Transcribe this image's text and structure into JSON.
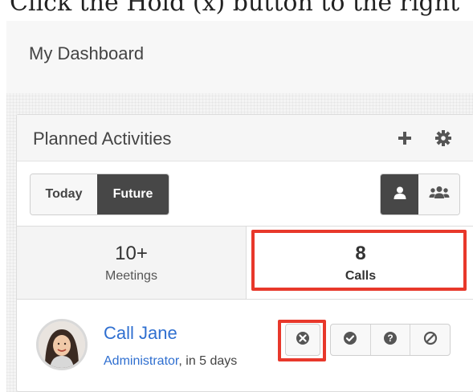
{
  "caption": {
    "text": "Click the Hold (x) button to the right"
  },
  "dashboard": {
    "title": "My Dashboard"
  },
  "dashlet": {
    "title": "Planned Activities",
    "range_buttons": [
      {
        "label": "Today"
      },
      {
        "label": "Future"
      }
    ],
    "selected_range": "Future"
  },
  "tabs": {
    "meetings": {
      "count": "10+",
      "label": "Meetings"
    },
    "calls": {
      "count": "8",
      "label": "Calls"
    }
  },
  "call": {
    "name": "Call Jane",
    "assignee": "Administrator",
    "due": ", in 5 days"
  },
  "colors": {
    "highlight": "#e8382b",
    "link": "#2f6fd0",
    "active_button": "#474747"
  }
}
